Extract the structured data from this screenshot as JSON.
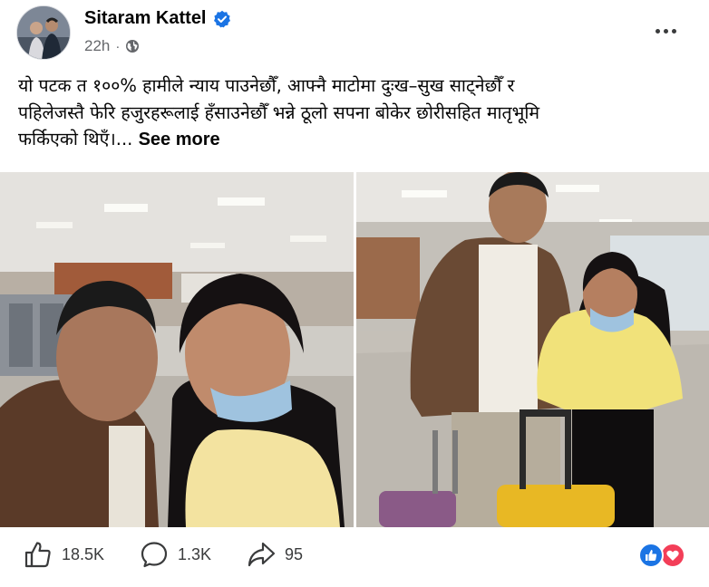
{
  "post": {
    "author": "Sitaram Kattel",
    "time": "22h",
    "meta_separator": "·",
    "text_lines": [
      "यो पटक त १००% हामीले न्याय पाउनेछौँ, आफ्नै माटोमा दुःख–सुख साट्नेछौँ र",
      "पहिलेजस्तै फेरि हजुरहरूलाई हँसाउनेछौँ भन्ने ठूलो सपना बोकेर छोरीसहित मातृभूमि",
      "फर्किएको थिएँ।..."
    ],
    "see_more": "See more",
    "icons": {
      "verified": "verified-badge-icon",
      "audience": "globe-icon",
      "options": "more-options-icon",
      "like": "thumbs-up-icon",
      "comment": "comment-bubble-icon",
      "share": "share-arrow-icon"
    }
  },
  "stats": {
    "likes": "18.5K",
    "comments": "1.3K",
    "shares": "95"
  },
  "colors": {
    "verified_blue": "#1b74e4",
    "like_blue": "#1b74e4",
    "love_red": "#f33e58",
    "secondary_text": "#65676b"
  }
}
